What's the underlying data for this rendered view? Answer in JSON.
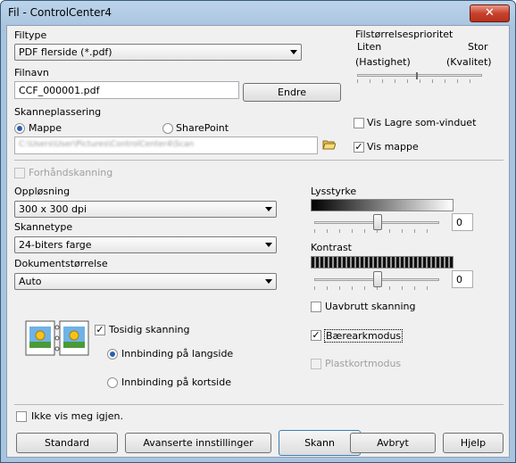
{
  "window": {
    "title": "Fil - ControlCenter4",
    "close_glyph": "✕"
  },
  "filtype": {
    "label": "Filtype",
    "value": "PDF flerside (*.pdf)"
  },
  "filnavn": {
    "label": "Filnavn",
    "value": "CCF_000001.pdf",
    "button": "Endre"
  },
  "priority": {
    "title": "Filstørrelsesprioritet",
    "low": "Liten",
    "high": "Stor",
    "low_sub": "(Hastighet)",
    "high_sub": "(Kvalitet)",
    "level": 0.5
  },
  "skanneplassering": {
    "label": "Skanneplassering",
    "option_folder": "Mappe",
    "option_sharepoint": "SharePoint",
    "selected": "Mappe",
    "path": "C:\\Users\\User\\Pictures\\ControlCenter4\\Scan"
  },
  "vis_lagre_som": {
    "label": "Vis Lagre som-vinduet",
    "checked": false
  },
  "vis_mappe": {
    "label": "Vis mappe",
    "checked": true
  },
  "forhandsskanning": {
    "label": "Forhåndskanning",
    "checked": false,
    "enabled": false
  },
  "opplosning": {
    "label": "Oppløsning",
    "value": "300 x 300 dpi"
  },
  "skannetype": {
    "label": "Skannetype",
    "value": "24-biters farge"
  },
  "dokumentstorrelse": {
    "label": "Dokumentstørrelse",
    "value": "Auto"
  },
  "lysstyrke": {
    "label": "Lysstyrke",
    "value": "0",
    "level": 0.5
  },
  "kontrast": {
    "label": "Kontrast",
    "value": "0",
    "level": 0.5
  },
  "uavbrutt": {
    "label": "Uavbrutt skanning",
    "checked": false
  },
  "baerearkmodus": {
    "label": "Bærearkmodus",
    "checked": true
  },
  "plastkortmodus": {
    "label": "Plastkortmodus",
    "checked": false,
    "enabled": false
  },
  "tosidig": {
    "label": "Tosidig skanning",
    "checked": true,
    "long_edge": "Innbinding på langside",
    "short_edge": "Innbinding på kortside",
    "selected": "long_edge"
  },
  "ikke_vis": {
    "label": "Ikke vis meg igjen.",
    "checked": false
  },
  "buttons": {
    "standard": "Standard",
    "advanced": "Avanserte innstillinger",
    "scan": "Skann",
    "cancel": "Avbryt",
    "help": "Hjelp"
  },
  "check_glyph": "✓",
  "icons": {
    "folder": "folder-icon",
    "duplex": "duplex-pages-icon"
  }
}
